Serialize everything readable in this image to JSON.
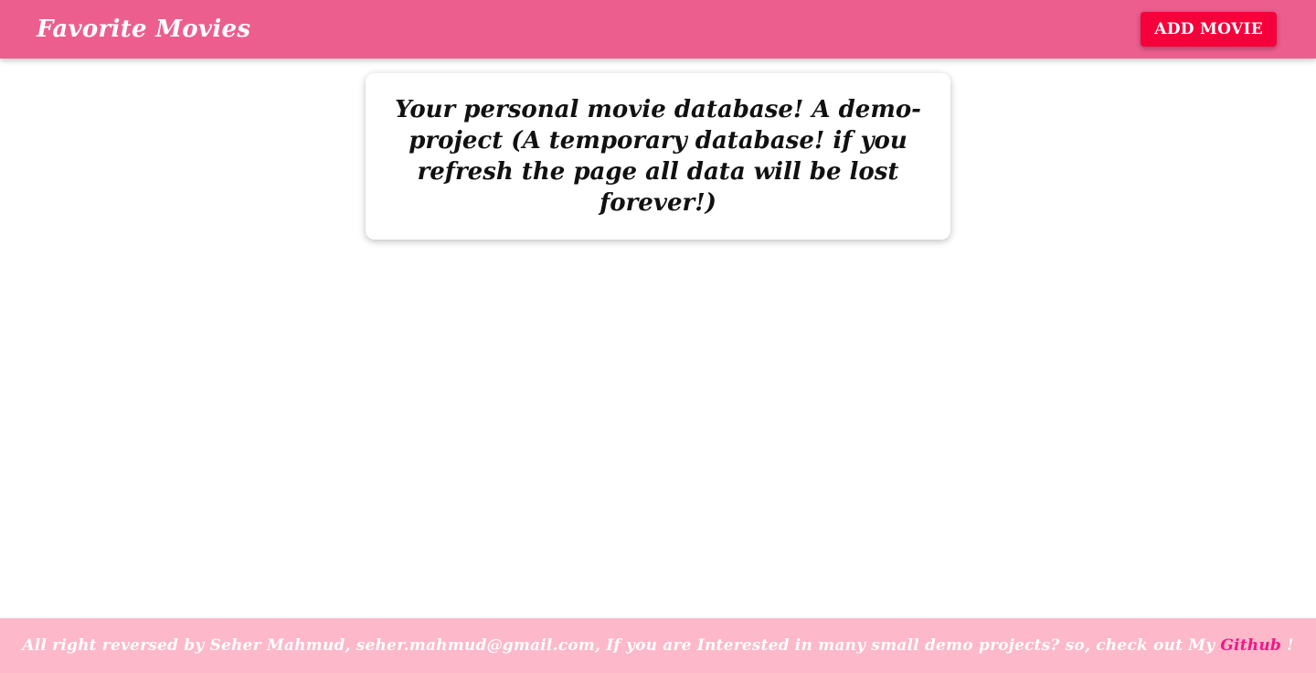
{
  "colors": {
    "header_bg": "#ec5e8e",
    "add_button_bg": "#f5003a",
    "footer_bg": "#fdb8ca",
    "link": "#f0188a"
  },
  "header": {
    "title": "Favorite Movies",
    "add_button_label": "ADD MOVIE"
  },
  "main": {
    "intro_text": "Your personal movie database! A demo-project (A temporary database! if you refresh the page all data will be lost forever!)"
  },
  "footer": {
    "text": "All right reversed by Seher Mahmud, seher.mahmud@gmail.com, If you are Interested in many small demo projects? so, check out My",
    "link_label": "Github",
    "suffix": "!"
  }
}
